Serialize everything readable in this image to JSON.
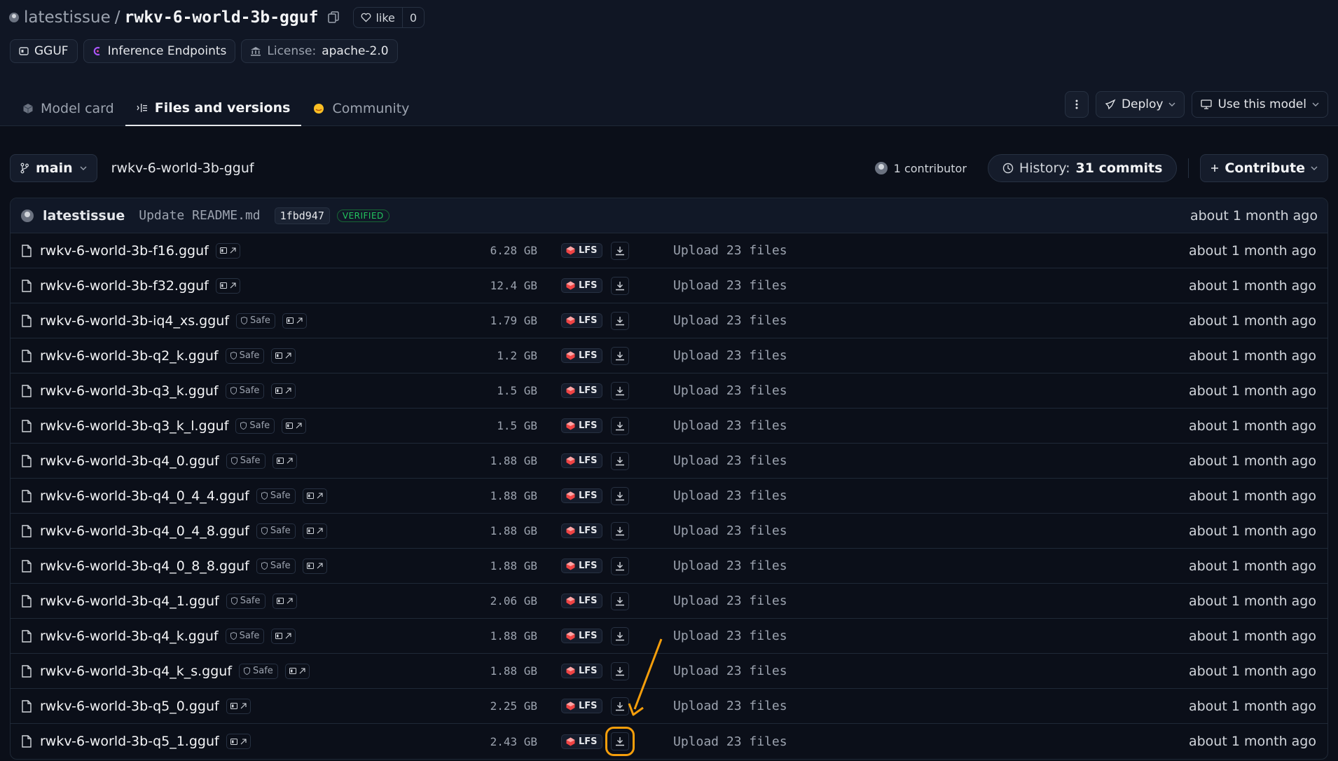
{
  "header": {
    "owner": "latestissue",
    "slash": "/",
    "repo": "rwkv-6-world-3b-gguf",
    "like_label": "like",
    "like_count": "0",
    "tags": [
      {
        "icon": "gguf-icon",
        "label": "GGUF"
      },
      {
        "icon": "inference-endpoints-icon",
        "label": "Inference Endpoints"
      }
    ],
    "license_label": "License:",
    "license_value": "apache-2.0"
  },
  "tabs": [
    {
      "label": "Model card",
      "icon": "cube-icon"
    },
    {
      "label": "Files and versions",
      "icon": "files-icon",
      "active": true
    },
    {
      "label": "Community",
      "icon": "community-icon"
    }
  ],
  "actions": {
    "deploy": "Deploy",
    "use_model": "Use this model"
  },
  "branch": {
    "name": "main",
    "path": "rwkv-6-world-3b-gguf",
    "contributors": "1 contributor",
    "history_label": "History:",
    "history_value": "31 commits",
    "contribute": "Contribute"
  },
  "last_commit": {
    "author": "latestissue",
    "message": "Update README.md",
    "sha": "1fbd947",
    "verified": "VERIFIED",
    "date": "about 1 month ago"
  },
  "files": [
    {
      "name": "rwkv-6-world-3b-f16.gguf",
      "safe": false,
      "size": "6.28 GB",
      "lfs": "LFS",
      "message": "Upload 23 files",
      "date": "about 1 month ago"
    },
    {
      "name": "rwkv-6-world-3b-f32.gguf",
      "safe": false,
      "size": "12.4 GB",
      "lfs": "LFS",
      "message": "Upload 23 files",
      "date": "about 1 month ago"
    },
    {
      "name": "rwkv-6-world-3b-iq4_xs.gguf",
      "safe": true,
      "size": "1.79 GB",
      "lfs": "LFS",
      "message": "Upload 23 files",
      "date": "about 1 month ago"
    },
    {
      "name": "rwkv-6-world-3b-q2_k.gguf",
      "safe": true,
      "size": "1.2 GB",
      "lfs": "LFS",
      "message": "Upload 23 files",
      "date": "about 1 month ago"
    },
    {
      "name": "rwkv-6-world-3b-q3_k.gguf",
      "safe": true,
      "size": "1.5 GB",
      "lfs": "LFS",
      "message": "Upload 23 files",
      "date": "about 1 month ago"
    },
    {
      "name": "rwkv-6-world-3b-q3_k_l.gguf",
      "safe": true,
      "size": "1.5 GB",
      "lfs": "LFS",
      "message": "Upload 23 files",
      "date": "about 1 month ago"
    },
    {
      "name": "rwkv-6-world-3b-q4_0.gguf",
      "safe": true,
      "size": "1.88 GB",
      "lfs": "LFS",
      "message": "Upload 23 files",
      "date": "about 1 month ago"
    },
    {
      "name": "rwkv-6-world-3b-q4_0_4_4.gguf",
      "safe": true,
      "size": "1.88 GB",
      "lfs": "LFS",
      "message": "Upload 23 files",
      "date": "about 1 month ago"
    },
    {
      "name": "rwkv-6-world-3b-q4_0_4_8.gguf",
      "safe": true,
      "size": "1.88 GB",
      "lfs": "LFS",
      "message": "Upload 23 files",
      "date": "about 1 month ago"
    },
    {
      "name": "rwkv-6-world-3b-q4_0_8_8.gguf",
      "safe": true,
      "size": "1.88 GB",
      "lfs": "LFS",
      "message": "Upload 23 files",
      "date": "about 1 month ago"
    },
    {
      "name": "rwkv-6-world-3b-q4_1.gguf",
      "safe": true,
      "size": "2.06 GB",
      "lfs": "LFS",
      "message": "Upload 23 files",
      "date": "about 1 month ago"
    },
    {
      "name": "rwkv-6-world-3b-q4_k.gguf",
      "safe": true,
      "size": "1.88 GB",
      "lfs": "LFS",
      "message": "Upload 23 files",
      "date": "about 1 month ago"
    },
    {
      "name": "rwkv-6-world-3b-q4_k_s.gguf",
      "safe": true,
      "size": "1.88 GB",
      "lfs": "LFS",
      "message": "Upload 23 files",
      "date": "about 1 month ago"
    },
    {
      "name": "rwkv-6-world-3b-q5_0.gguf",
      "safe": false,
      "size": "2.25 GB",
      "lfs": "LFS",
      "message": "Upload 23 files",
      "date": "about 1 month ago"
    },
    {
      "name": "rwkv-6-world-3b-q5_1.gguf",
      "safe": false,
      "size": "2.43 GB",
      "lfs": "LFS",
      "message": "Upload 23 files",
      "date": "about 1 month ago",
      "highlighted": true
    }
  ],
  "safe_label": "Safe",
  "colors": {
    "background": "#0b0f19",
    "accent_highlight": "#f59e0b",
    "lfs_red": "#ef4444",
    "verified_green": "#22c55e"
  }
}
